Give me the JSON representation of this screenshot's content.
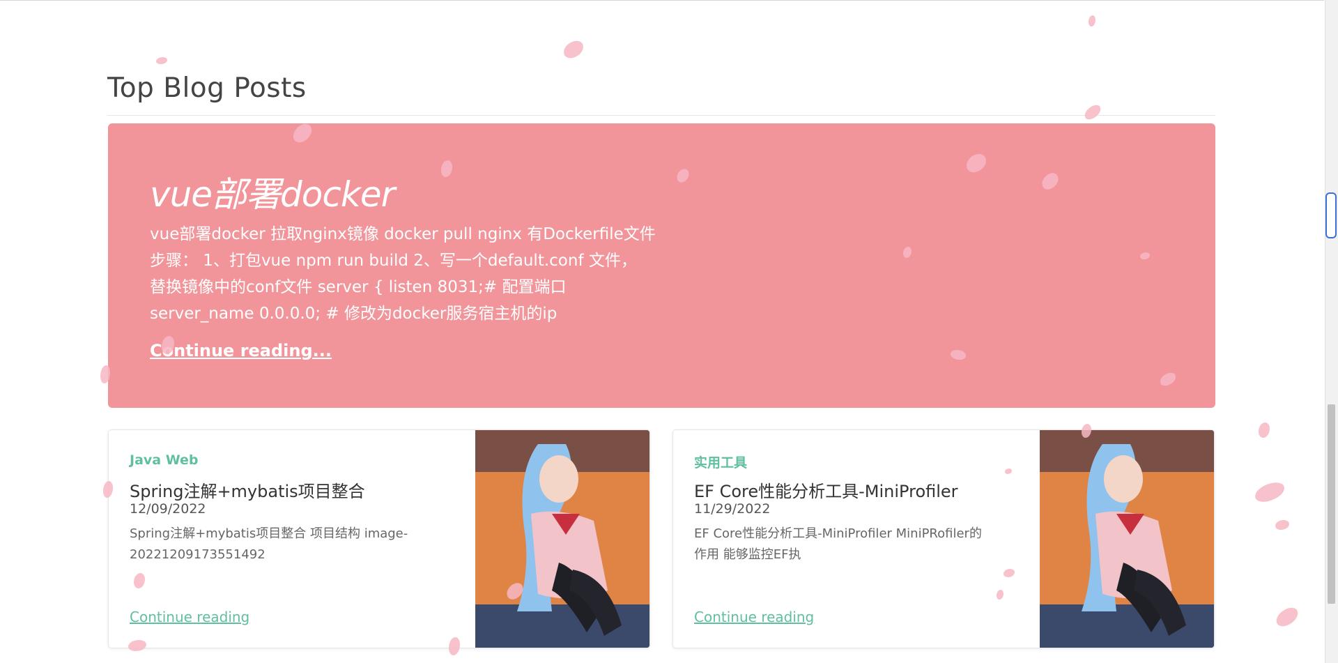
{
  "section": {
    "title": "Top Blog Posts"
  },
  "featured": {
    "title": "vue部署docker",
    "excerpt_lines": [
      "vue部署docker 拉取nginx镜像 docker pull nginx 有Dockerfile文件",
      "步骤： 1、打包vue npm run build 2、写一个default.conf 文件，",
      "替换镜像中的conf文件 server { listen 8031;# 配置端口",
      "server_name 0.0.0.0; # 修改为docker服务宿主机的ip"
    ],
    "link": "Continue reading..."
  },
  "cards": [
    {
      "category": "Java Web",
      "title": "Spring注解+mybatis项目整合",
      "date": "12/09/2022",
      "excerpt_lines": [
        "Spring注解+mybatis项目整合 项目结构 image-",
        "20221209173551492"
      ],
      "link": "Continue reading"
    },
    {
      "category": "实用工具",
      "title": "EF Core性能分析工具-MiniProfiler",
      "date": "11/29/2022",
      "excerpt_lines": [
        "EF Core性能分析工具-MiniProfiler MiniPRofiler的",
        "作用 能够监控EF执"
      ],
      "link": "Continue reading"
    }
  ],
  "colors": {
    "featured_bg": "#f2959a",
    "accent_green": "#5fbf9f",
    "petal": "#f7b7c4"
  }
}
